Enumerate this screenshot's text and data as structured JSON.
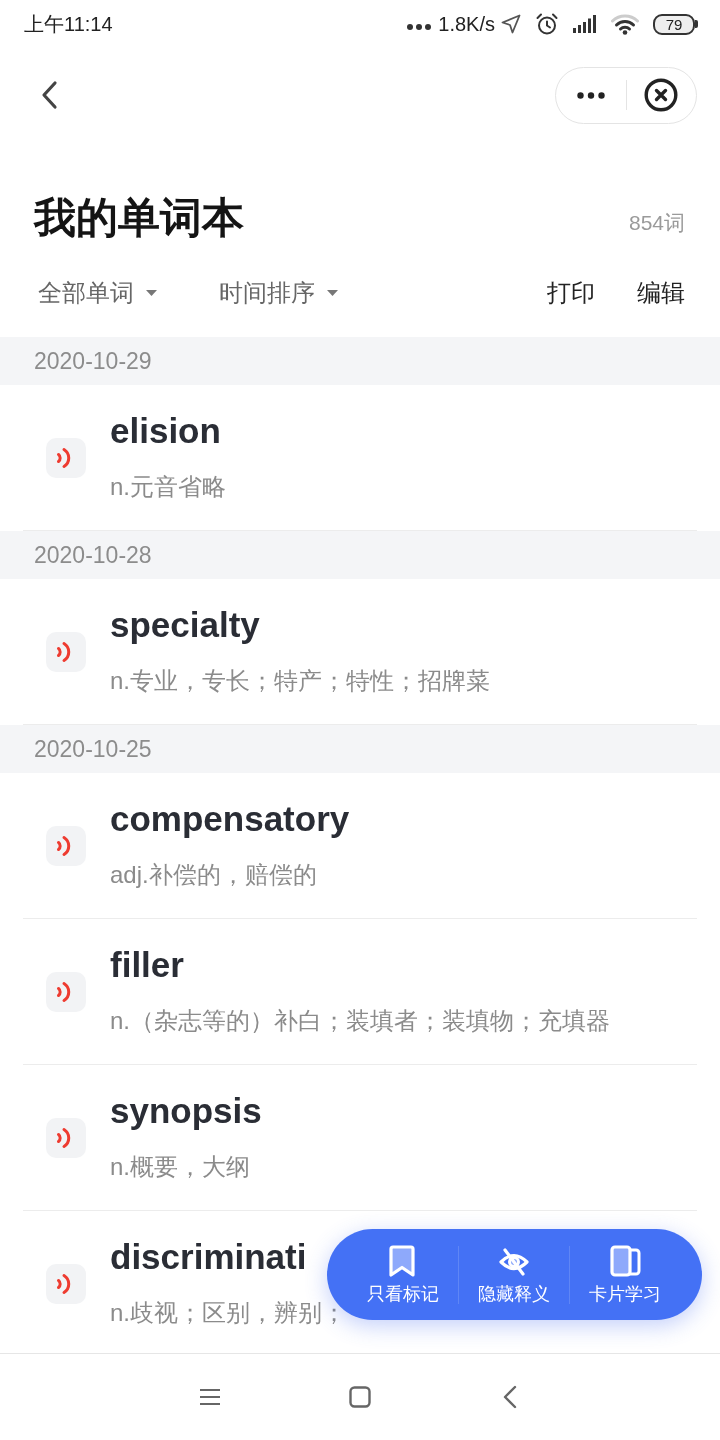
{
  "status_bar": {
    "time": "上午11:14",
    "network_speed": "1.8K/s",
    "battery": "79"
  },
  "header": {
    "title": "我的单词本",
    "word_count": "854词"
  },
  "toolbar": {
    "filters": [
      "全部单词",
      "时间排序"
    ],
    "actions": [
      "打印",
      "编辑"
    ]
  },
  "sections": [
    {
      "date": "2020-10-29",
      "entries": [
        {
          "word": "elision",
          "definition": "n.元音省略"
        }
      ]
    },
    {
      "date": "2020-10-28",
      "entries": [
        {
          "word": "specialty",
          "definition": "n.专业，专长；特产；特性；招牌菜"
        }
      ]
    },
    {
      "date": "2020-10-25",
      "entries": [
        {
          "word": "compensatory",
          "definition": "adj.补偿的，赔偿的"
        },
        {
          "word": "filler",
          "definition": "n.（杂志等的）补白；装填者；装填物；充填器"
        },
        {
          "word": "synopsis",
          "definition": "n.概要，大纲"
        },
        {
          "word": "discriminati",
          "definition": "n.歧视；区别，辨别；"
        }
      ]
    }
  ],
  "floating_bar": {
    "buttons": [
      "只看标记",
      "隐藏释义",
      "卡片学习"
    ]
  }
}
